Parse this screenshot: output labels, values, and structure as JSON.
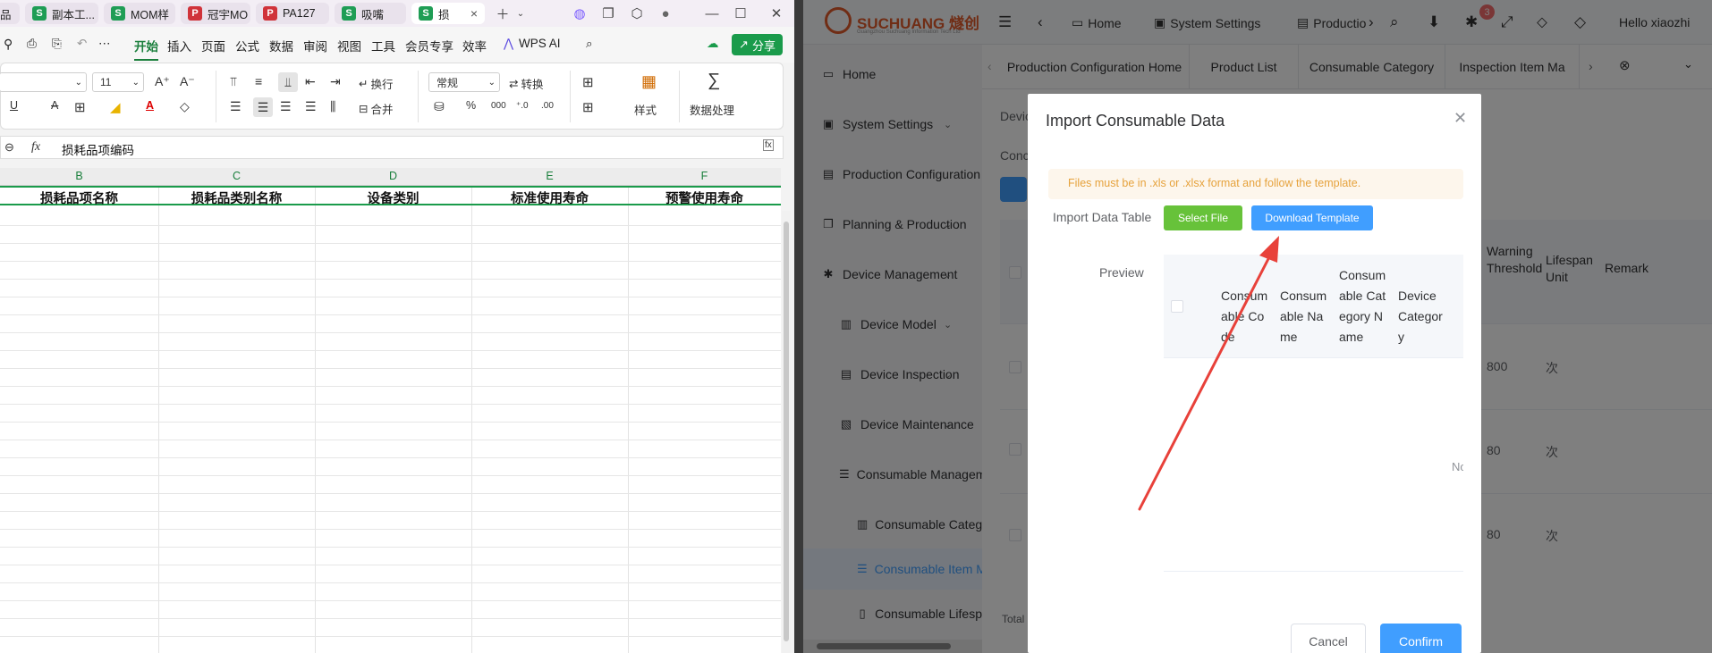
{
  "wps": {
    "tabs": [
      {
        "label": "品"
      },
      {
        "label": "副本工..."
      },
      {
        "label": "MOM样"
      },
      {
        "label": "冠宇MO"
      },
      {
        "label": "PA127"
      },
      {
        "label": "吸嘴"
      },
      {
        "label": "损"
      }
    ],
    "menu": [
      "开始",
      "插入",
      "页面",
      "公式",
      "数据",
      "审阅",
      "视图",
      "工具",
      "会员专享",
      "效率",
      "WPS AI"
    ],
    "share_label": "分享",
    "ribbon": {
      "font_size": "11",
      "wrap_label": "换行",
      "number_format": "常规",
      "convert_label": "转换",
      "merge_label": "合并",
      "style_label": "样式",
      "data_proc_label": "数据处理"
    },
    "formula_bar": {
      "fx": "fx",
      "content": "损耗品项编码"
    },
    "columns": [
      "B",
      "C",
      "D",
      "E",
      "F"
    ],
    "header_cells": [
      "损耗品项名称",
      "损耗品类别名称",
      "设备类别",
      "标准使用寿命",
      "预警使用寿命"
    ]
  },
  "app": {
    "logo_text": "SUCHUANG 燧创",
    "logo_subtitle": "Guangzhou Suchuang Information Tech Ltd",
    "topnav": {
      "home": "Home",
      "settings": "System Settings",
      "production": "Productio",
      "badge": "3",
      "greeting": "Hello xiaozhi"
    },
    "sidebar": [
      {
        "label": "Home"
      },
      {
        "label": "System Settings"
      },
      {
        "label": "Production Configuration"
      },
      {
        "label": "Planning & Production"
      },
      {
        "label": "Device Management"
      },
      {
        "label": "Device Model"
      },
      {
        "label": "Device Inspection"
      },
      {
        "label": "Device Maintenance"
      },
      {
        "label": "Consumable Managem"
      },
      {
        "label": "Consumable Category"
      },
      {
        "label": "Consumable Item M"
      },
      {
        "label": "Consumable Lifesp"
      }
    ],
    "page_tabs": [
      "Production Configuration Home",
      "Product List",
      "Consumable Category",
      "Inspection Item Ma"
    ],
    "bg_table": {
      "labels": [
        "Devic",
        "Conc"
      ],
      "headers": [
        "Warning Threshold",
        "Lifespan Unit",
        "Remark"
      ],
      "rows": [
        {
          "threshold": "800",
          "unit": "次"
        },
        {
          "threshold": "80",
          "unit": "次"
        },
        {
          "threshold": "80",
          "unit": "次"
        }
      ],
      "footer": "Total"
    }
  },
  "dialog": {
    "title": "Import Consumable Data",
    "alert": "Files must be in .xls or .xlsx format and follow the template.",
    "import_label": "Import Data Table",
    "select_label": "Select File",
    "download_label": "Download Template",
    "preview_label": "Preview",
    "preview_headers": [
      "Consumable Code",
      "Consumable Name",
      "Consumable Category Name",
      "Device Category"
    ],
    "empty_text": "No",
    "cancel_label": "Cancel",
    "confirm_label": "Confirm"
  },
  "colors": {
    "wps_green": "#1a9b4b",
    "primary": "#409eff",
    "success": "#67c23a",
    "warning": "#e6a23c",
    "annotation": "#e8413a"
  }
}
